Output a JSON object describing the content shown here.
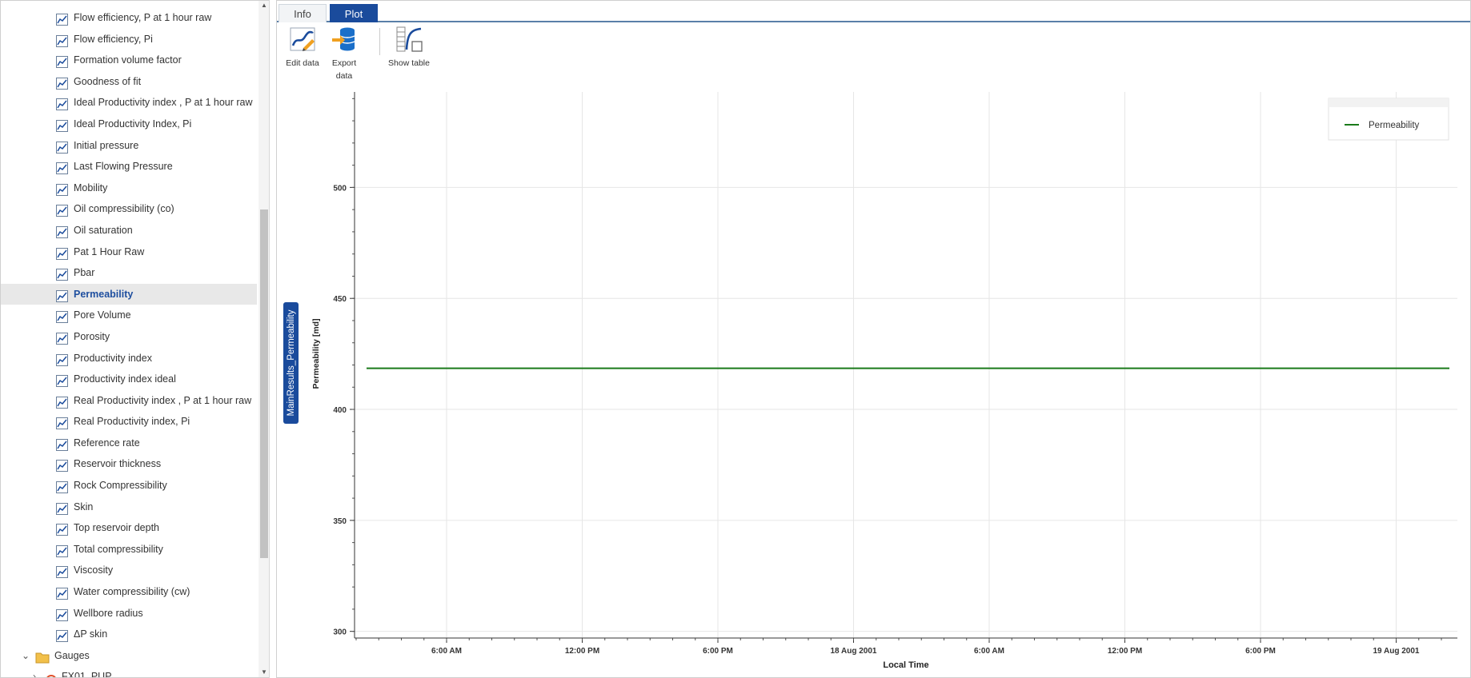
{
  "tree": {
    "items": [
      {
        "label": "Flow efficiency, P at 1 hour raw",
        "selected": false
      },
      {
        "label": "Flow efficiency, Pi",
        "selected": false
      },
      {
        "label": "Formation volume factor",
        "selected": false
      },
      {
        "label": "Goodness of fit",
        "selected": false
      },
      {
        "label": "Ideal Productivity index , P at 1 hour raw",
        "selected": false
      },
      {
        "label": "Ideal Productivity Index, Pi",
        "selected": false
      },
      {
        "label": "Initial pressure",
        "selected": false
      },
      {
        "label": "Last Flowing Pressure",
        "selected": false
      },
      {
        "label": "Mobility",
        "selected": false
      },
      {
        "label": "Oil compressibility (co)",
        "selected": false
      },
      {
        "label": "Oil saturation",
        "selected": false
      },
      {
        "label": "Pat 1 Hour Raw",
        "selected": false
      },
      {
        "label": "Pbar",
        "selected": false
      },
      {
        "label": "Permeability",
        "selected": true
      },
      {
        "label": "Pore Volume",
        "selected": false
      },
      {
        "label": "Porosity",
        "selected": false
      },
      {
        "label": "Productivity index",
        "selected": false
      },
      {
        "label": "Productivity index ideal",
        "selected": false
      },
      {
        "label": "Real Productivity index , P at 1 hour raw",
        "selected": false
      },
      {
        "label": "Real Productivity index, Pi",
        "selected": false
      },
      {
        "label": "Reference rate",
        "selected": false
      },
      {
        "label": "Reservoir thickness",
        "selected": false
      },
      {
        "label": "Rock Compressibility",
        "selected": false
      },
      {
        "label": "Skin",
        "selected": false
      },
      {
        "label": "Top reservoir depth",
        "selected": false
      },
      {
        "label": "Total compressibility",
        "selected": false
      },
      {
        "label": "Viscosity",
        "selected": false
      },
      {
        "label": "Water compressibility (cw)",
        "selected": false
      },
      {
        "label": "Wellbore radius",
        "selected": false
      },
      {
        "label": "ΔP skin",
        "selected": false
      }
    ],
    "folder": {
      "label": "Gauges",
      "expanded": true
    },
    "partial_item": {
      "label": "FX01_PUP"
    }
  },
  "tabs": [
    {
      "label": "Info",
      "active": false
    },
    {
      "label": "Plot",
      "active": true
    }
  ],
  "toolbar": {
    "edit_label": "Edit data",
    "export_label_1": "Export",
    "export_label_2": "data",
    "table_label": "Show table"
  },
  "series_tag": "MainResults_Permeability",
  "colors": {
    "accent": "#1a4b9c",
    "line": "#1a7a1a"
  },
  "chart_data": {
    "type": "line",
    "xlabel": "Local Time",
    "ylabel": "Permeability [md]",
    "x_ticks": [
      "6:00 AM",
      "12:00 PM",
      "6:00 PM",
      "18 Aug 2001",
      "6:00 AM",
      "12:00 PM",
      "6:00 PM",
      "19 Aug 2001"
    ],
    "y_ticks": [
      300,
      350,
      400,
      450,
      500
    ],
    "ylim": [
      297,
      543
    ],
    "grid": true,
    "legend_position": "top-right",
    "series": [
      {
        "name": "Permeability",
        "x": [
          "17 Aug 2001 2:00 AM",
          "19 Aug 2001 2:30 AM"
        ],
        "values": [
          418.5,
          418.5
        ]
      }
    ]
  }
}
